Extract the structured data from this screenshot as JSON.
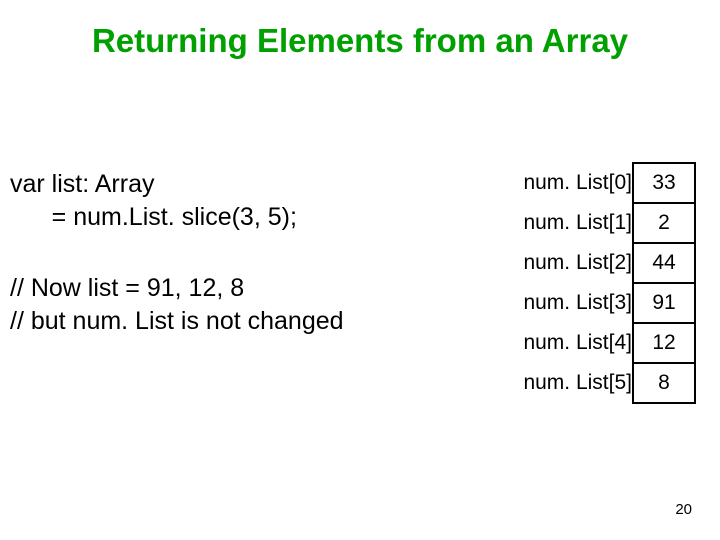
{
  "title": "Returning Elements from an Array",
  "code": {
    "line1": "var list: Array",
    "line2": "      = num.List. slice(3, 5);",
    "line3": "// Now list = 91, 12, 8",
    "line4": "// but num. List is not changed"
  },
  "array": {
    "rows": [
      {
        "label": "num. List[0]",
        "value": "33"
      },
      {
        "label": "num. List[1]",
        "value": "2"
      },
      {
        "label": "num. List[2]",
        "value": "44"
      },
      {
        "label": "num. List[3]",
        "value": "91"
      },
      {
        "label": "num. List[4]",
        "value": "12"
      },
      {
        "label": "num. List[5]",
        "value": "8"
      }
    ]
  },
  "page_number": "20"
}
